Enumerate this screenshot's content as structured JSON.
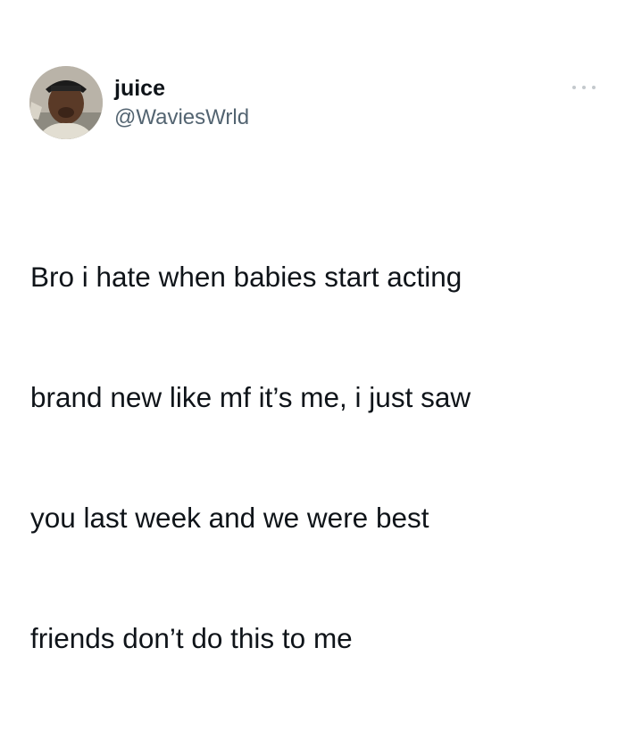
{
  "author": {
    "display_name": "juice",
    "handle": "@WaviesWrld",
    "avatar_icon": "profile-photo"
  },
  "menu": {
    "icon": "more-options-icon"
  },
  "tweet": {
    "lines": [
      "Bro i hate when babies start acting",
      "brand new like mf it’s me, i just saw",
      "you last week and we were best",
      "friends don’t do this to me"
    ]
  },
  "colors": {
    "text": "#0f1419",
    "secondary_text": "#536471",
    "background": "#ffffff"
  }
}
